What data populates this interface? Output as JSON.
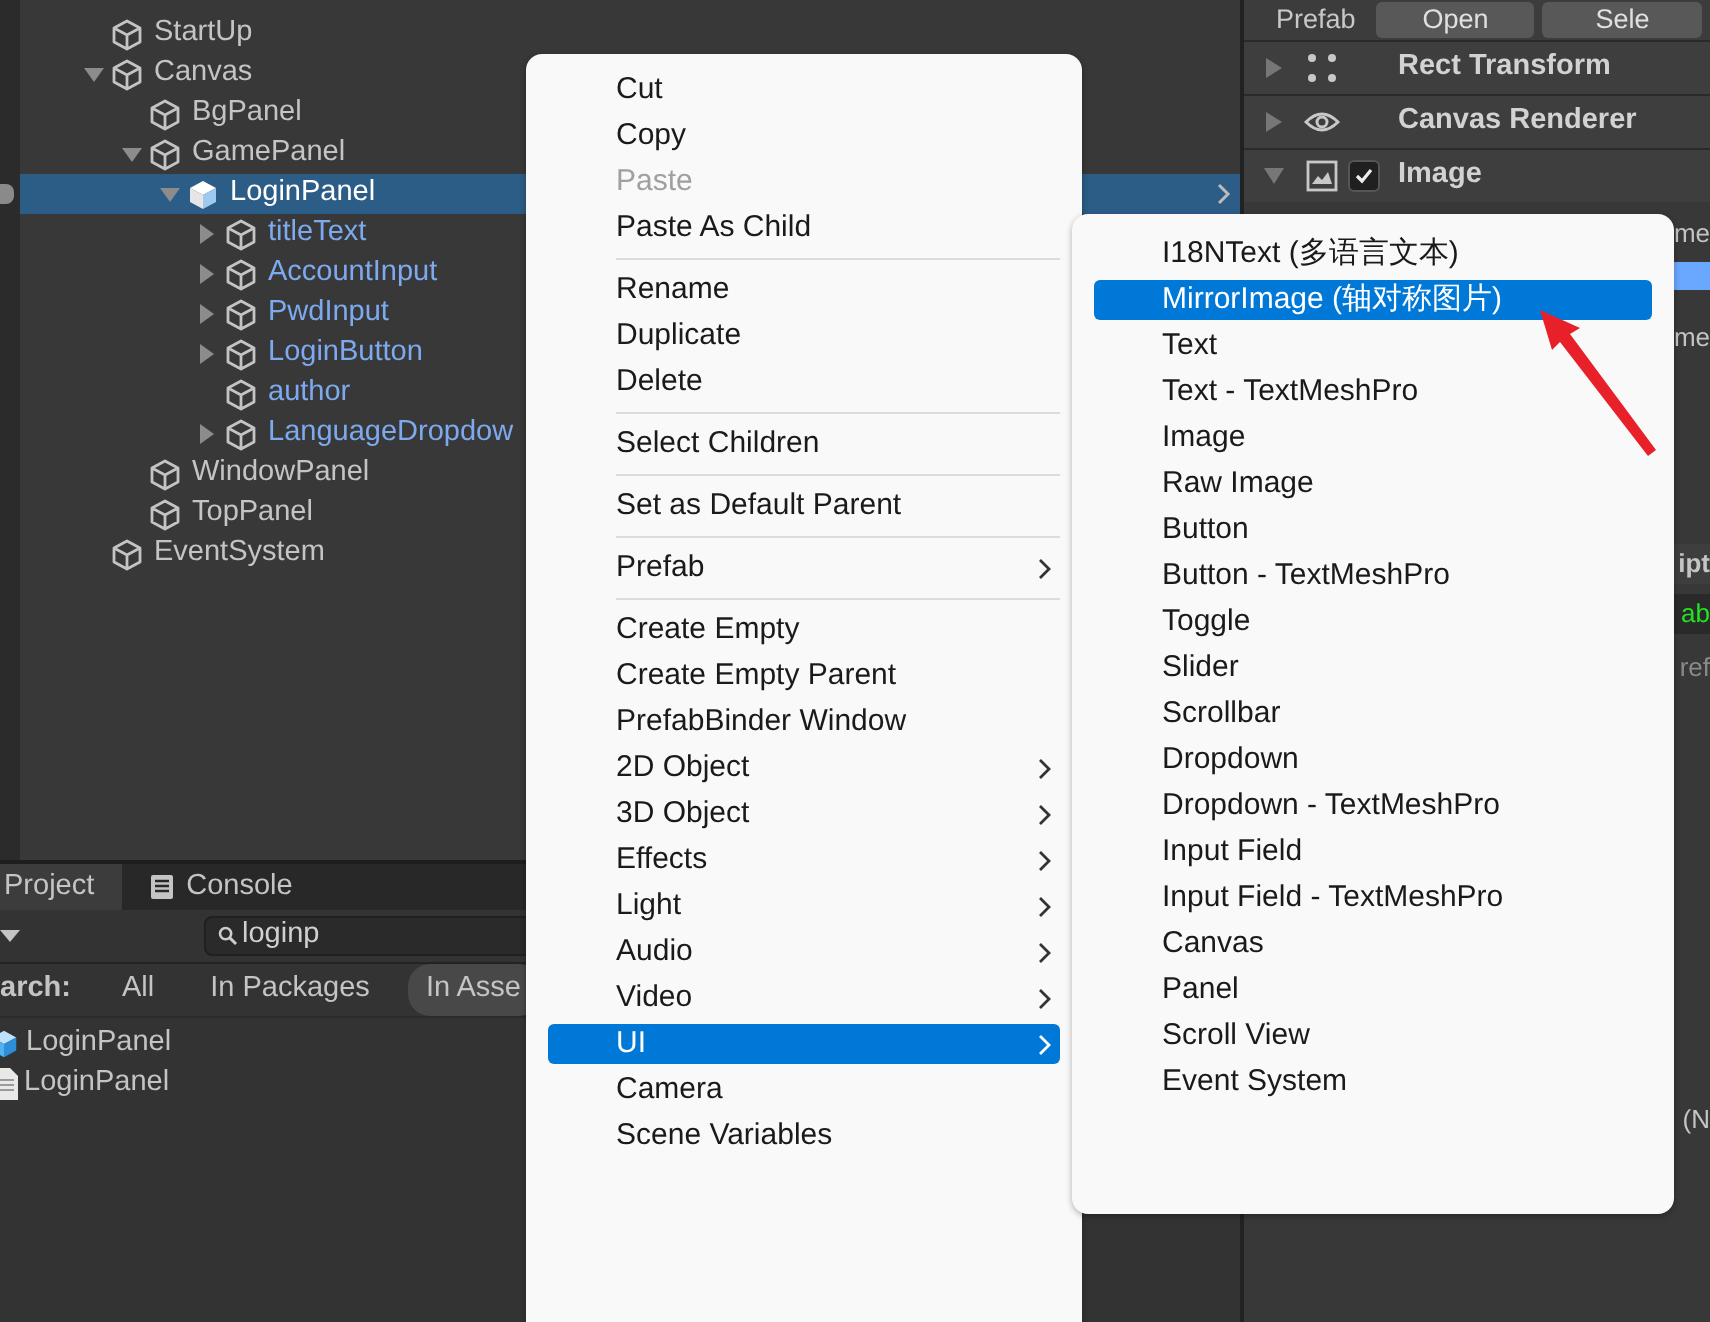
{
  "hierarchy": {
    "items": [
      {
        "label": "StartUp",
        "selected": false,
        "prefab": false
      },
      {
        "label": "Canvas",
        "expanded": true,
        "selected": false,
        "prefab": false,
        "children": [
          {
            "label": "BgPanel",
            "selected": false,
            "prefab": false
          },
          {
            "label": "GamePanel",
            "expanded": true,
            "selected": false,
            "prefab": false,
            "children": [
              {
                "label": "LoginPanel",
                "expanded": true,
                "selected": true,
                "prefab": true,
                "prefab_arrow": true,
                "children": [
                  {
                    "label": "titleText",
                    "expanded": false,
                    "selected": false,
                    "prefab": true
                  },
                  {
                    "label": "AccountInput",
                    "expanded": false,
                    "selected": false,
                    "prefab": true
                  },
                  {
                    "label": "PwdInput",
                    "expanded": false,
                    "selected": false,
                    "prefab": true
                  },
                  {
                    "label": "LoginButton",
                    "expanded": false,
                    "selected": false,
                    "prefab": true
                  },
                  {
                    "label": "author",
                    "selected": false,
                    "prefab": true
                  },
                  {
                    "label": "LanguageDropdow",
                    "expanded": false,
                    "selected": false,
                    "prefab": true
                  }
                ]
              }
            ]
          },
          {
            "label": "WindowPanel",
            "selected": false,
            "prefab": false
          },
          {
            "label": "TopPanel",
            "selected": false,
            "prefab": false
          }
        ]
      },
      {
        "label": "EventSystem",
        "selected": false,
        "prefab": false
      }
    ]
  },
  "project": {
    "tabs": [
      {
        "label": "Project",
        "selected": true,
        "kind": "folder"
      },
      {
        "label": "Console",
        "selected": false,
        "kind": "console"
      }
    ],
    "search": {
      "value": "loginp"
    },
    "filter_label": "arch:",
    "filters": [
      {
        "label": "All",
        "selected": false
      },
      {
        "label": "In Packages",
        "selected": false
      },
      {
        "label": "In Asse",
        "selected": true
      }
    ],
    "results": [
      {
        "label": "LoginPanel",
        "kind": "prefab"
      },
      {
        "label": "LoginPanel",
        "kind": "script"
      }
    ]
  },
  "inspector": {
    "prefab_label": "Prefab",
    "prefab_buttons": [
      "Open",
      "Sele"
    ],
    "components": [
      {
        "name": "Rect Transform",
        "kind": "rect",
        "expanded": false
      },
      {
        "name": "Canvas Renderer",
        "kind": "eye",
        "expanded": false
      },
      {
        "name": "Image",
        "kind": "image",
        "expanded": true,
        "checked": true
      }
    ],
    "fragments": [
      {
        "kind": "label",
        "text": "me"
      },
      {
        "kind": "highlight"
      },
      {
        "kind": "label",
        "text": "me"
      },
      {
        "kind": "header",
        "text": "ipt"
      },
      {
        "kind": "value",
        "text": "ab"
      },
      {
        "kind": "hint",
        "text": "ref"
      },
      {
        "kind": "label",
        "text": "(N"
      }
    ]
  },
  "context_menu": {
    "items": [
      {
        "kind": "item",
        "label": "Cut",
        "disabled": false,
        "submenu": false,
        "selected": false
      },
      {
        "kind": "item",
        "label": "Copy",
        "disabled": false,
        "submenu": false,
        "selected": false
      },
      {
        "kind": "item",
        "label": "Paste",
        "disabled": true,
        "submenu": false,
        "selected": false
      },
      {
        "kind": "item",
        "label": "Paste As Child",
        "disabled": false,
        "submenu": false,
        "selected": false
      },
      {
        "kind": "separator"
      },
      {
        "kind": "item",
        "label": "Rename",
        "disabled": false,
        "submenu": false,
        "selected": false
      },
      {
        "kind": "item",
        "label": "Duplicate",
        "disabled": false,
        "submenu": false,
        "selected": false
      },
      {
        "kind": "item",
        "label": "Delete",
        "disabled": false,
        "submenu": false,
        "selected": false
      },
      {
        "kind": "separator"
      },
      {
        "kind": "item",
        "label": "Select Children",
        "disabled": false,
        "submenu": false,
        "selected": false
      },
      {
        "kind": "separator"
      },
      {
        "kind": "item",
        "label": "Set as Default Parent",
        "disabled": false,
        "submenu": false,
        "selected": false
      },
      {
        "kind": "separator"
      },
      {
        "kind": "item",
        "label": "Prefab",
        "disabled": false,
        "submenu": true,
        "selected": false
      },
      {
        "kind": "separator"
      },
      {
        "kind": "item",
        "label": "Create Empty",
        "disabled": false,
        "submenu": false,
        "selected": false
      },
      {
        "kind": "item",
        "label": "Create Empty Parent",
        "disabled": false,
        "submenu": false,
        "selected": false
      },
      {
        "kind": "item",
        "label": "PrefabBinder Window",
        "disabled": false,
        "submenu": false,
        "selected": false
      },
      {
        "kind": "item",
        "label": "2D Object",
        "disabled": false,
        "submenu": true,
        "selected": false
      },
      {
        "kind": "item",
        "label": "3D Object",
        "disabled": false,
        "submenu": true,
        "selected": false
      },
      {
        "kind": "item",
        "label": "Effects",
        "disabled": false,
        "submenu": true,
        "selected": false
      },
      {
        "kind": "item",
        "label": "Light",
        "disabled": false,
        "submenu": true,
        "selected": false
      },
      {
        "kind": "item",
        "label": "Audio",
        "disabled": false,
        "submenu": true,
        "selected": false
      },
      {
        "kind": "item",
        "label": "Video",
        "disabled": false,
        "submenu": true,
        "selected": false
      },
      {
        "kind": "item",
        "label": "UI",
        "disabled": false,
        "submenu": true,
        "selected": true
      },
      {
        "kind": "item",
        "label": "Camera",
        "disabled": false,
        "submenu": false,
        "selected": false
      },
      {
        "kind": "item",
        "label": "Scene Variables",
        "disabled": false,
        "submenu": false,
        "selected": false
      }
    ]
  },
  "submenu": {
    "items": [
      {
        "kind": "item",
        "label": "I18NText (多语言文本)",
        "disabled": false,
        "submenu": false,
        "selected": false
      },
      {
        "kind": "item",
        "label": "MirrorImage (轴对称图片)",
        "disabled": false,
        "submenu": false,
        "selected": true
      },
      {
        "kind": "item",
        "label": "Text",
        "disabled": false,
        "submenu": false,
        "selected": false
      },
      {
        "kind": "item",
        "label": "Text - TextMeshPro",
        "disabled": false,
        "submenu": false,
        "selected": false
      },
      {
        "kind": "item",
        "label": "Image",
        "disabled": false,
        "submenu": false,
        "selected": false
      },
      {
        "kind": "item",
        "label": "Raw Image",
        "disabled": false,
        "submenu": false,
        "selected": false
      },
      {
        "kind": "item",
        "label": "Button",
        "disabled": false,
        "submenu": false,
        "selected": false
      },
      {
        "kind": "item",
        "label": "Button - TextMeshPro",
        "disabled": false,
        "submenu": false,
        "selected": false
      },
      {
        "kind": "item",
        "label": "Toggle",
        "disabled": false,
        "submenu": false,
        "selected": false
      },
      {
        "kind": "item",
        "label": "Slider",
        "disabled": false,
        "submenu": false,
        "selected": false
      },
      {
        "kind": "item",
        "label": "Scrollbar",
        "disabled": false,
        "submenu": false,
        "selected": false
      },
      {
        "kind": "item",
        "label": "Dropdown",
        "disabled": false,
        "submenu": false,
        "selected": false
      },
      {
        "kind": "item",
        "label": "Dropdown - TextMeshPro",
        "disabled": false,
        "submenu": false,
        "selected": false
      },
      {
        "kind": "item",
        "label": "Input Field",
        "disabled": false,
        "submenu": false,
        "selected": false
      },
      {
        "kind": "item",
        "label": "Input Field - TextMeshPro",
        "disabled": false,
        "submenu": false,
        "selected": false
      },
      {
        "kind": "item",
        "label": "Canvas",
        "disabled": false,
        "submenu": false,
        "selected": false
      },
      {
        "kind": "item",
        "label": "Panel",
        "disabled": false,
        "submenu": false,
        "selected": false
      },
      {
        "kind": "item",
        "label": "Scroll View",
        "disabled": false,
        "submenu": false,
        "selected": false
      },
      {
        "kind": "item",
        "label": "Event System",
        "disabled": false,
        "submenu": false,
        "selected": false
      }
    ]
  }
}
